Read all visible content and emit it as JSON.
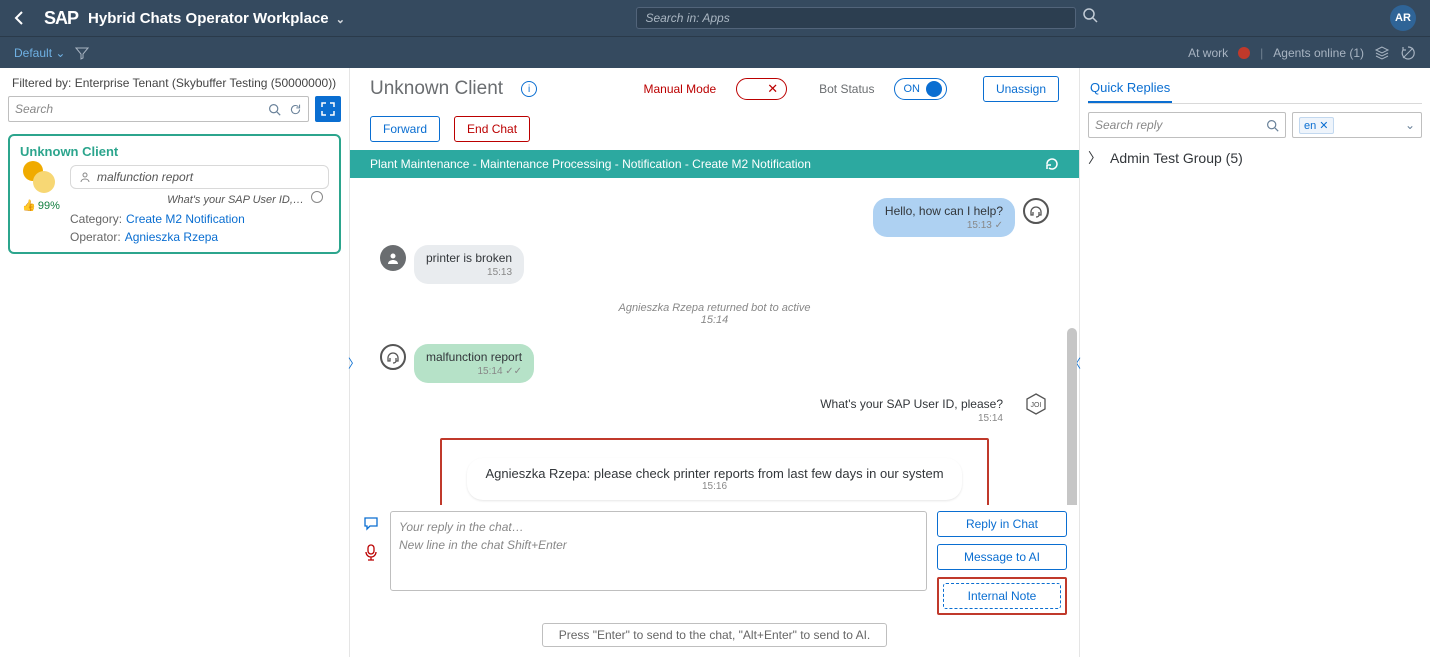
{
  "header": {
    "sap": "SAP",
    "app_title": "Hybrid Chats Operator Workplace",
    "search_placeholder": "Search in: Apps",
    "avatar": "AR"
  },
  "subbar": {
    "default": "Default",
    "at_work": "At work",
    "agents_online": "Agents online (1)"
  },
  "left": {
    "filter_line": "Filtered by: Enterprise Tenant (Skybuffer Testing (50000000))",
    "search_placeholder": "Search",
    "card": {
      "title": "Unknown Client",
      "report": "malfunction report",
      "preview": "What's your SAP User ID,…",
      "thumb": "99%",
      "category_label": "Category:",
      "category_value": "Create M2 Notification",
      "operator_label": "Operator:",
      "operator_value": "Agnieszka Rzepa"
    }
  },
  "chat": {
    "client": "Unknown Client",
    "manual_label": "Manual Mode",
    "bot_label": "Bot Status",
    "bot_state": "ON",
    "unassign": "Unassign",
    "forward": "Forward",
    "end": "End Chat",
    "breadcrumb": "Plant Maintenance - Maintenance Processing - Notification - Create M2 Notification",
    "m1": {
      "text": "Hello, how can I help?",
      "time": "15:13 ✓"
    },
    "m2": {
      "text": "printer is broken",
      "time": "15:13"
    },
    "sys": {
      "text": "Agnieszka Rzepa returned bot to active",
      "time": "15:14"
    },
    "m3": {
      "text": "malfunction report",
      "time": "15:14 ✓✓"
    },
    "m4": {
      "text": "What's your SAP User ID, please?",
      "time": "15:14"
    },
    "note": {
      "text": "Agnieszka Rzepa: please check printer reports from last few days in our system",
      "time": "15:16"
    }
  },
  "compose": {
    "line1": "Your reply in the chat…",
    "line2": "New line in the chat Shift+Enter",
    "reply": "Reply in Chat",
    "ai": "Message to AI",
    "note": "Internal Note",
    "hint": "Press \"Enter\" to send to the chat, \"Alt+Enter\" to send to AI."
  },
  "right": {
    "tab": "Quick Replies",
    "search_placeholder": "Search reply",
    "lang": "en",
    "group": "Admin Test Group (5)"
  }
}
